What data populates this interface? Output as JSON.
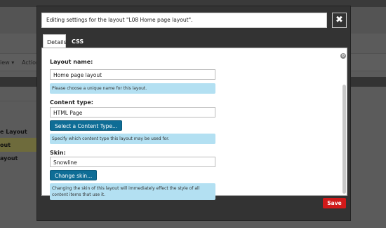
{
  "background": {
    "toolbar_items": [
      "iew ▾",
      "Action"
    ],
    "rows": [
      "e Layout",
      "out",
      "ayout"
    ]
  },
  "modal": {
    "title": "Editing settings for the layout \"L08 Home page layout\".",
    "close_label": "✖",
    "tabs": [
      {
        "label": "Details",
        "active": true
      },
      {
        "label": "CSS",
        "active": false
      }
    ],
    "gear_label": "⚙",
    "layout_name": {
      "label": "Layout name:",
      "value": "Home page layout",
      "help": "Please choose a unique name for this layout."
    },
    "content_type": {
      "label": "Content type:",
      "value": "HTML Page",
      "button": "Select a Content Type...",
      "help": "Specify which content type this layout may be used for."
    },
    "skin": {
      "label": "Skin:",
      "value": "Snowline",
      "button": "Change skin...",
      "help": "Changing the skin of this layout will immediately effect the style of all content items that use it."
    },
    "save_label": "Save"
  },
  "colors": {
    "save_button": "#d11a1a",
    "primary_button": "#0e6d96",
    "help_background": "#b3e0f2"
  }
}
